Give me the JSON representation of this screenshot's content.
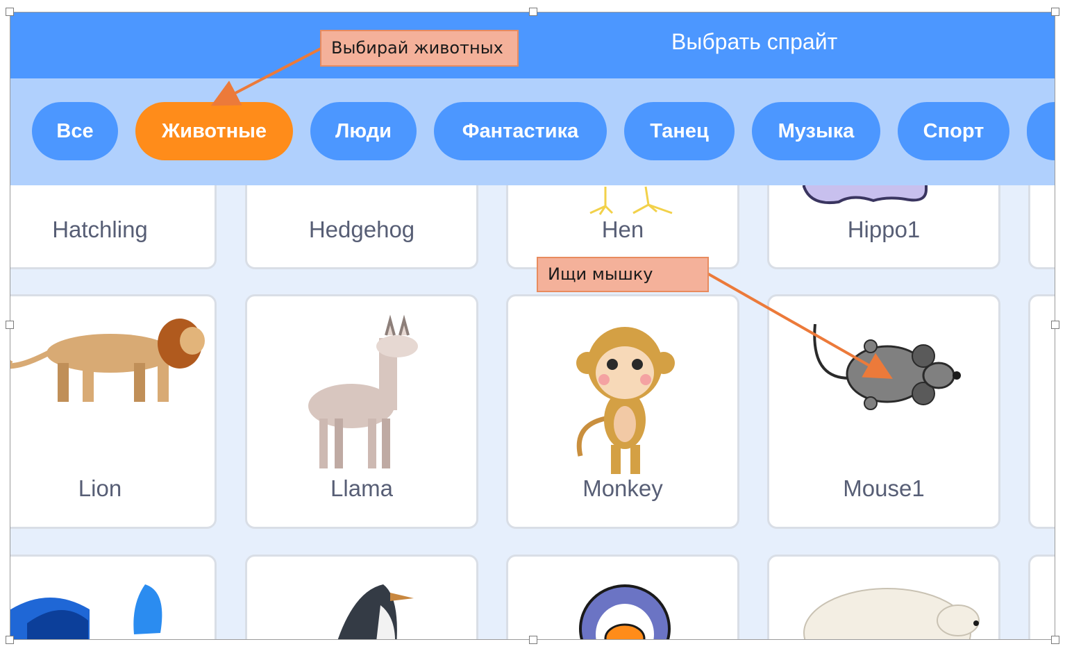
{
  "header": {
    "title": "Выбрать спрайт"
  },
  "filters": [
    "Все",
    "Животные",
    "Люди",
    "Фантастика",
    "Танец",
    "Музыка",
    "Спорт"
  ],
  "active_filter": "Животные",
  "sprites": {
    "row1": [
      "Hatchling",
      "Hedgehog",
      "Hen",
      "Hippo1"
    ],
    "row2": [
      "Lion",
      "Llama",
      "Monkey",
      "Mouse1"
    ]
  },
  "annotations": {
    "callout1": "Выбирай животных",
    "callout2": "Ищи мышку"
  },
  "colors": {
    "header": "#4c97ff",
    "filter_bar": "#b0d0fd",
    "active_pill": "#ff8c1a",
    "callout_fill": "#f4b19a",
    "arrow": "#ec7a3a"
  }
}
